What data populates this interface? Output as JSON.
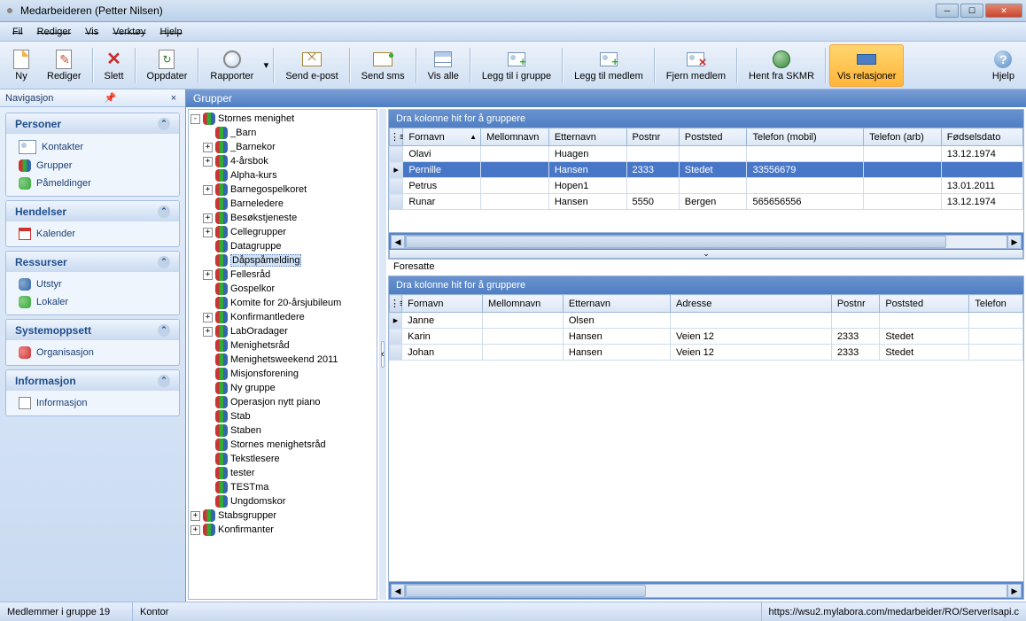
{
  "window": {
    "title": "Medarbeideren (Petter Nilsen)"
  },
  "menu": {
    "file": "Fil",
    "edit": "Rediger",
    "view": "Vis",
    "tools": "Verktøy",
    "help": "Hjelp"
  },
  "toolbar": {
    "new": "Ny",
    "edit": "Rediger",
    "delete": "Slett",
    "update": "Oppdater",
    "reports": "Rapporter",
    "sendmail": "Send e-post",
    "sendsms": "Send sms",
    "showall": "Vis alle",
    "addgroup": "Legg til i gruppe",
    "addmember": "Legg til medlem",
    "removemember": "Fjern medlem",
    "skmr": "Hent fra SKMR",
    "relations": "Vis relasjoner",
    "helpbtn": "Hjelp"
  },
  "nav": {
    "header": "Navigasjon",
    "groups": {
      "persons": {
        "title": "Personer",
        "items": [
          "Kontakter",
          "Grupper",
          "Påmeldinger"
        ]
      },
      "events": {
        "title": "Hendelser",
        "items": [
          "Kalender"
        ]
      },
      "resources": {
        "title": "Ressurser",
        "items": [
          "Utstyr",
          "Lokaler"
        ]
      },
      "system": {
        "title": "Systemoppsett",
        "items": [
          "Organisasjon"
        ]
      },
      "info": {
        "title": "Informasjon",
        "items": [
          "Informasjon"
        ]
      }
    }
  },
  "main": {
    "header": "Grupper"
  },
  "tree": {
    "root": "Stornes menighet",
    "children": [
      {
        "l": "_Barn",
        "exp": ""
      },
      {
        "l": "_Barnekor",
        "exp": "+"
      },
      {
        "l": "4-årsbok",
        "exp": "+"
      },
      {
        "l": "Alpha-kurs",
        "exp": ""
      },
      {
        "l": "Barnegospelkoret",
        "exp": "+"
      },
      {
        "l": "Barneledere",
        "exp": ""
      },
      {
        "l": "Besøkstjeneste",
        "exp": "+"
      },
      {
        "l": "Cellegrupper",
        "exp": "+"
      },
      {
        "l": "Datagruppe",
        "exp": ""
      },
      {
        "l": "Dåpspåmelding",
        "exp": "",
        "sel": true
      },
      {
        "l": "Fellesråd",
        "exp": "+"
      },
      {
        "l": "Gospelkor",
        "exp": ""
      },
      {
        "l": "Komite for 20-årsjubileum",
        "exp": ""
      },
      {
        "l": "Konfirmantledere",
        "exp": "+"
      },
      {
        "l": "LabOradager",
        "exp": "+"
      },
      {
        "l": "Menighetsråd",
        "exp": ""
      },
      {
        "l": "Menighetsweekend 2011",
        "exp": ""
      },
      {
        "l": "Misjonsforening",
        "exp": ""
      },
      {
        "l": "Ny gruppe",
        "exp": ""
      },
      {
        "l": "Operasjon nytt piano",
        "exp": ""
      },
      {
        "l": "Stab",
        "exp": ""
      },
      {
        "l": "Staben",
        "exp": ""
      },
      {
        "l": "Stornes menighetsråd",
        "exp": ""
      },
      {
        "l": "Tekstlesere",
        "exp": ""
      },
      {
        "l": "tester",
        "exp": ""
      },
      {
        "l": "TESTma",
        "exp": ""
      },
      {
        "l": "Ungdomskor",
        "exp": ""
      }
    ],
    "siblings": [
      {
        "l": "Stabsgrupper",
        "exp": "+"
      },
      {
        "l": "Konfirmanter",
        "exp": "+"
      }
    ]
  },
  "grid1": {
    "groupbar": "Dra kolonne hit for å gruppere",
    "cols": [
      "Fornavn",
      "Mellomnavn",
      "Etternavn",
      "Postnr",
      "Poststed",
      "Telefon (mobil)",
      "Telefon (arb)",
      "Fødselsdato"
    ],
    "rows": [
      {
        "fornavn": "Olavi",
        "mellomnavn": "",
        "etternavn": "Huagen",
        "postnr": "",
        "poststed": "",
        "mobil": "",
        "arb": "",
        "dob": "13.12.1974"
      },
      {
        "fornavn": "Pernille",
        "mellomnavn": "",
        "etternavn": "Hansen",
        "postnr": "2333",
        "poststed": "Stedet",
        "mobil": "33556679",
        "arb": "",
        "dob": "",
        "selected": true
      },
      {
        "fornavn": "Petrus",
        "mellomnavn": "",
        "etternavn": "Hopen1",
        "postnr": "",
        "poststed": "",
        "mobil": "",
        "arb": "",
        "dob": "13.01.2011"
      },
      {
        "fornavn": "Runar",
        "mellomnavn": "",
        "etternavn": "Hansen",
        "postnr": "5550",
        "poststed": "Bergen",
        "mobil": "565656556",
        "arb": "",
        "dob": "13.12.1974"
      }
    ]
  },
  "section2": "Foresatte",
  "grid2": {
    "groupbar": "Dra kolonne hit for å gruppere",
    "cols": [
      "Fornavn",
      "Mellomnavn",
      "Etternavn",
      "Adresse",
      "Postnr",
      "Poststed",
      "Telefon"
    ],
    "rows": [
      {
        "fornavn": "Janne",
        "mellomnavn": "",
        "etternavn": "Olsen",
        "adresse": "",
        "postnr": "",
        "poststed": "",
        "tlf": "",
        "cur": true
      },
      {
        "fornavn": "Karin",
        "mellomnavn": "",
        "etternavn": "Hansen",
        "adresse": "Veien 12",
        "postnr": "2333",
        "poststed": "Stedet",
        "tlf": ""
      },
      {
        "fornavn": "Johan",
        "mellomnavn": "",
        "etternavn": "Hansen",
        "adresse": "Veien 12",
        "postnr": "2333",
        "poststed": "Stedet",
        "tlf": ""
      }
    ]
  },
  "status": {
    "left": "Medlemmer i gruppe 19",
    "mid": "Kontor",
    "url": "https://wsu2.mylabora.com/medarbeider/RO/ServerIsapi.c"
  }
}
